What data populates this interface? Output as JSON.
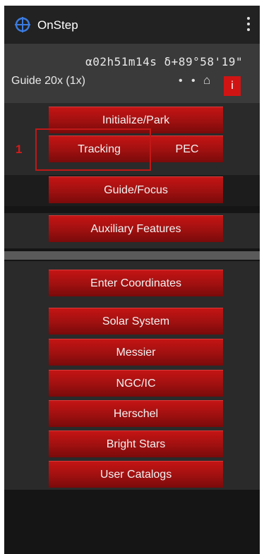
{
  "app": {
    "title": "OnStep",
    "icon": "crosshair-target-icon",
    "menu_icon": "overflow-menu-icon"
  },
  "status": {
    "coordinates": "α02h51m14s δ+89°58'19\"",
    "guide_rate": "Guide 20x (1x)",
    "indicators": "• •",
    "home_icon_glyph": "⌂",
    "info_label": "i"
  },
  "annotation": {
    "marker": "1"
  },
  "menu": {
    "initialize_park": "Initialize/Park",
    "tracking": "Tracking",
    "pec": "PEC",
    "guide_focus": "Guide/Focus",
    "auxiliary": "Auxiliary Features",
    "enter_coordinates": "Enter Coordinates",
    "catalogs": [
      "Solar System",
      "Messier",
      "NGC/IC",
      "Herschel",
      "Bright Stars",
      "User Catalogs"
    ]
  },
  "colors": {
    "button": "#b01010",
    "highlight": "#c01818",
    "accent_icon": "#2e6fd6"
  }
}
